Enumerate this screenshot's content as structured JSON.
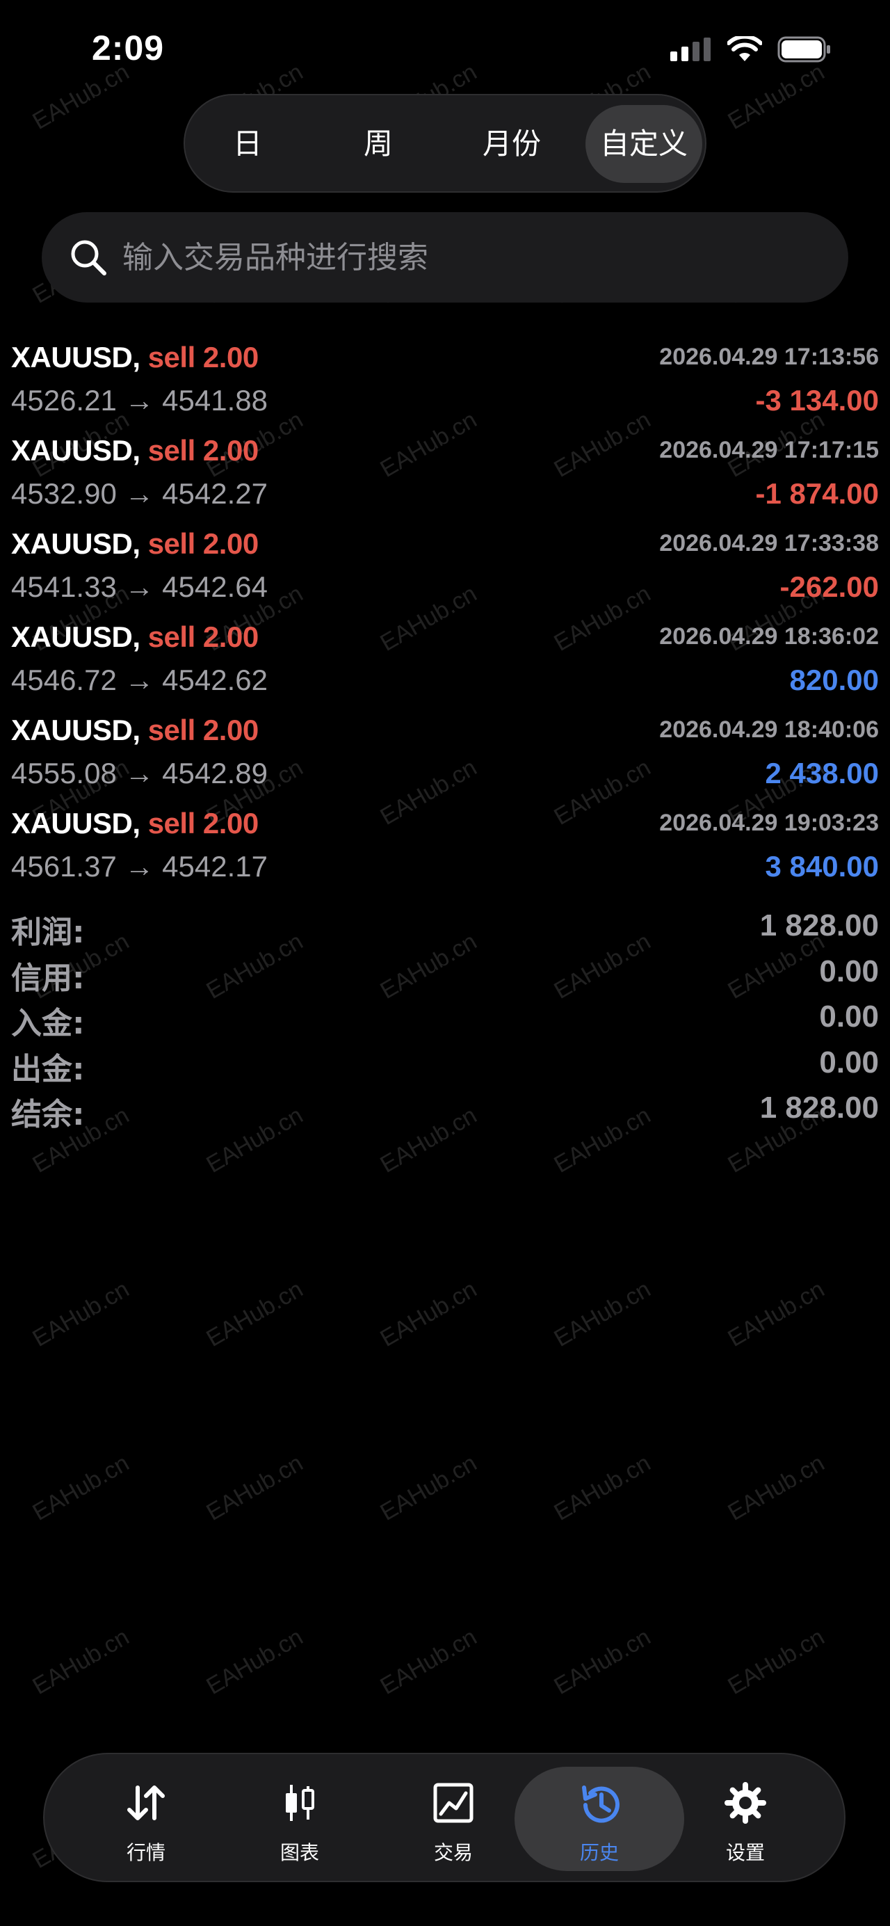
{
  "status_bar": {
    "time": "2:09"
  },
  "period_tabs": [
    {
      "label": "日",
      "active": false
    },
    {
      "label": "周",
      "active": false
    },
    {
      "label": "月份",
      "active": false
    },
    {
      "label": "自定义",
      "active": true
    }
  ],
  "search": {
    "placeholder": "输入交易品种进行搜索",
    "value": ""
  },
  "trades": [
    {
      "symbol": "XAUUSD,",
      "side": "sell 2.00",
      "time": "2026.04.29 17:13:56",
      "prices": "4526.21 → 4541.88",
      "profit": "-3 134.00",
      "sign": "neg"
    },
    {
      "symbol": "XAUUSD,",
      "side": "sell 2.00",
      "time": "2026.04.29 17:17:15",
      "prices": "4532.90 → 4542.27",
      "profit": "-1 874.00",
      "sign": "neg"
    },
    {
      "symbol": "XAUUSD,",
      "side": "sell 2.00",
      "time": "2026.04.29 17:33:38",
      "prices": "4541.33 → 4542.64",
      "profit": "-262.00",
      "sign": "neg"
    },
    {
      "symbol": "XAUUSD,",
      "side": "sell 2.00",
      "time": "2026.04.29 18:36:02",
      "prices": "4546.72 → 4542.62",
      "profit": "820.00",
      "sign": "pos"
    },
    {
      "symbol": "XAUUSD,",
      "side": "sell 2.00",
      "time": "2026.04.29 18:40:06",
      "prices": "4555.08 → 4542.89",
      "profit": "2 438.00",
      "sign": "pos"
    },
    {
      "symbol": "XAUUSD,",
      "side": "sell 2.00",
      "time": "2026.04.29 19:03:23",
      "prices": "4561.37 → 4542.17",
      "profit": "3 840.00",
      "sign": "pos"
    }
  ],
  "summary": [
    {
      "label": "利润:",
      "value": "1 828.00"
    },
    {
      "label": "信用:",
      "value": "0.00"
    },
    {
      "label": "入金:",
      "value": "0.00"
    },
    {
      "label": "出金:",
      "value": "0.00"
    },
    {
      "label": "结余:",
      "value": "1 828.00"
    }
  ],
  "watermark": "EAHub.cn",
  "tabbar": [
    {
      "label": "行情",
      "icon": "quotes-arrows-icon",
      "active": false
    },
    {
      "label": "图表",
      "icon": "candlestick-chart-icon",
      "active": false
    },
    {
      "label": "交易",
      "icon": "trade-line-chart-icon",
      "active": false
    },
    {
      "label": "历史",
      "icon": "history-clock-icon",
      "active": true
    },
    {
      "label": "设置",
      "icon": "settings-gear-icon",
      "active": false
    }
  ],
  "colors": {
    "background": "#000000",
    "loss": "#e5574b",
    "profit": "#4a86f0",
    "active_tab_label": "#4a86f0",
    "secondary_text": "#a1a1a6"
  }
}
